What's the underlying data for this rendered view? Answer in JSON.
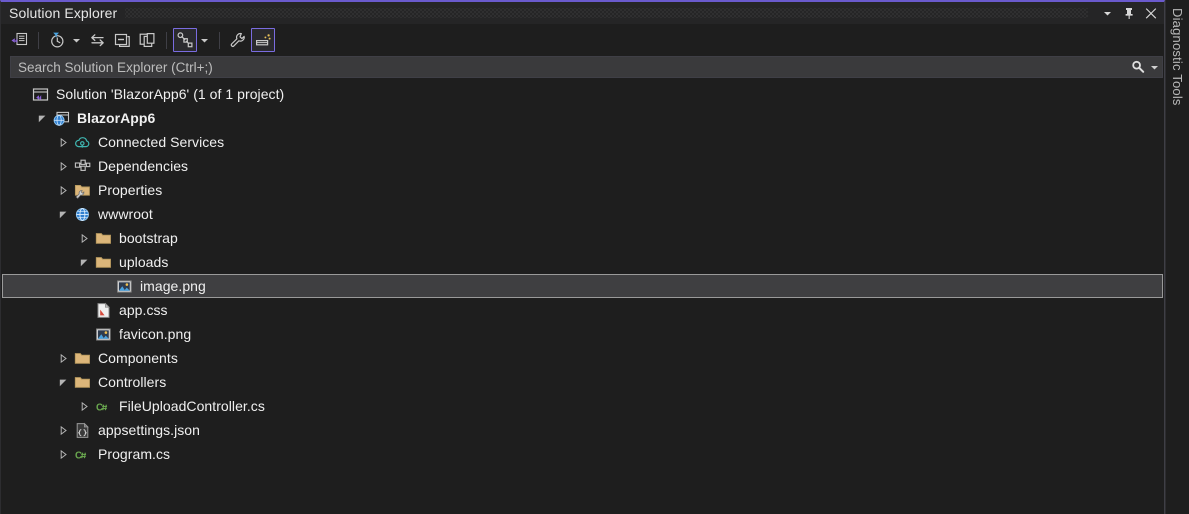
{
  "window": {
    "title": "Solution Explorer",
    "accent_color": "#6a5acd",
    "titlebar_buttons": [
      {
        "name": "window-dropdown",
        "label": "▾"
      },
      {
        "name": "auto-hide-pin",
        "label": "Auto Hide"
      },
      {
        "name": "close",
        "label": "Close"
      }
    ]
  },
  "toolbar": {
    "buttons": [
      {
        "id": "home",
        "label": "Home",
        "icon": "solution-home-icon",
        "active": false
      },
      {
        "id": "pending-changes",
        "label": "Pending Changes Filter",
        "icon": "clock-filter-icon",
        "active": false
      },
      {
        "id": "pending-changes-dropdown",
        "label": "Filter options",
        "icon": "chevron-down-icon",
        "active": false
      },
      {
        "id": "sync-with-active-document",
        "label": "Sync with Active Document",
        "icon": "sync-arrows-icon",
        "active": false
      },
      {
        "id": "collapse-all",
        "label": "Collapse All",
        "icon": "collapse-all-icon",
        "active": false
      },
      {
        "id": "show-all-files",
        "label": "Show All Files",
        "icon": "show-all-files-icon",
        "active": false
      },
      {
        "id": "view-code-map",
        "label": "View Code Map",
        "icon": "code-map-icon",
        "active": true
      },
      {
        "id": "view-code-map-dropdown",
        "label": "Code map options",
        "icon": "chevron-down-icon",
        "active": false
      },
      {
        "id": "properties",
        "label": "Properties",
        "icon": "wrench-icon",
        "active": false
      },
      {
        "id": "preview-selected-items",
        "label": "Preview Selected Items",
        "icon": "preview-item-icon",
        "active": true
      }
    ]
  },
  "search": {
    "placeholder": "Search Solution Explorer (Ctrl+;)",
    "value": "",
    "icon": "search-icon",
    "dropdown_icon": "chevron-down-icon"
  },
  "tree": {
    "rows": [
      {
        "id": "solution",
        "label": "Solution 'BlazorApp6' (1 of 1 project)",
        "depth": 0,
        "expander": "none",
        "icon": "solution-icon",
        "bold": false,
        "selected": false
      },
      {
        "id": "project-blazorapp6",
        "label": "BlazorApp6",
        "depth": 1,
        "expander": "expanded",
        "icon": "web-project-icon",
        "bold": true,
        "selected": false
      },
      {
        "id": "connected-services",
        "label": "Connected Services",
        "depth": 2,
        "expander": "collapsed",
        "icon": "connected-services-icon",
        "bold": false,
        "selected": false
      },
      {
        "id": "dependencies",
        "label": "Dependencies",
        "depth": 2,
        "expander": "collapsed",
        "icon": "dependencies-icon",
        "bold": false,
        "selected": false
      },
      {
        "id": "properties",
        "label": "Properties",
        "depth": 2,
        "expander": "collapsed",
        "icon": "properties-folder-icon",
        "bold": false,
        "selected": false
      },
      {
        "id": "wwwroot",
        "label": "wwwroot",
        "depth": 2,
        "expander": "expanded",
        "icon": "wwwroot-icon",
        "bold": false,
        "selected": false
      },
      {
        "id": "bootstrap",
        "label": "bootstrap",
        "depth": 3,
        "expander": "collapsed",
        "icon": "folder-icon",
        "bold": false,
        "selected": false
      },
      {
        "id": "uploads",
        "label": "uploads",
        "depth": 3,
        "expander": "expanded",
        "icon": "folder-icon",
        "bold": false,
        "selected": false
      },
      {
        "id": "image-png",
        "label": "image.png",
        "depth": 4,
        "expander": "none",
        "icon": "image-file-icon",
        "bold": false,
        "selected": true
      },
      {
        "id": "app-css",
        "label": "app.css",
        "depth": 3,
        "expander": "none",
        "icon": "css-file-icon",
        "bold": false,
        "selected": false
      },
      {
        "id": "favicon-png",
        "label": "favicon.png",
        "depth": 3,
        "expander": "none",
        "icon": "image-file-icon",
        "bold": false,
        "selected": false
      },
      {
        "id": "components",
        "label": "Components",
        "depth": 2,
        "expander": "collapsed",
        "icon": "folder-icon",
        "bold": false,
        "selected": false
      },
      {
        "id": "controllers",
        "label": "Controllers",
        "depth": 2,
        "expander": "expanded",
        "icon": "folder-icon",
        "bold": false,
        "selected": false
      },
      {
        "id": "fileuploadcontroller-cs",
        "label": "FileUploadController.cs",
        "depth": 3,
        "expander": "collapsed",
        "icon": "csharp-file-icon",
        "bold": false,
        "selected": false
      },
      {
        "id": "appsettings-json",
        "label": "appsettings.json",
        "depth": 2,
        "expander": "collapsed",
        "icon": "json-file-icon",
        "bold": false,
        "selected": false
      },
      {
        "id": "program-cs",
        "label": "Program.cs",
        "depth": 2,
        "expander": "collapsed",
        "icon": "csharp-file-icon",
        "bold": false,
        "selected": false
      }
    ]
  },
  "right_tabs": [
    {
      "id": "diagnostic-tools",
      "label": "Diagnostic Tools"
    }
  ],
  "colors": {
    "background": "#1e1e1e",
    "titlebar": "#252526",
    "accent": "#6a5acd",
    "selection": "#3f3f41",
    "selection_border": "#9a9a9a",
    "search_background": "#3a3a3c",
    "folder": "#dcb67a",
    "csharp_green": "#6aa84f",
    "text": "#f0f0f0"
  }
}
